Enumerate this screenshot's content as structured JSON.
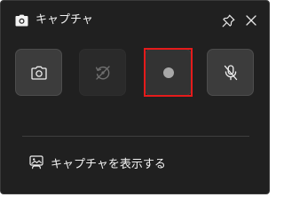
{
  "window": {
    "title": "キャプチャ"
  },
  "toolbar": {
    "buttons": [
      {
        "name": "screenshot",
        "icon": "camera-icon",
        "state": "enabled"
      },
      {
        "name": "record-last-30s",
        "icon": "replay-icon",
        "state": "disabled"
      },
      {
        "name": "start-recording",
        "icon": "record-dot-icon",
        "state": "enabled",
        "highlighted": true
      },
      {
        "name": "mic-toggle",
        "icon": "mic-muted-icon",
        "state": "enabled"
      }
    ]
  },
  "footer": {
    "show_captures_label": "キャプチャを表示する"
  },
  "colors": {
    "panel_bg": "#202020",
    "button_bg": "#3c3c3c",
    "highlight_border": "#e41b1b",
    "text": "#f2f2f2"
  }
}
